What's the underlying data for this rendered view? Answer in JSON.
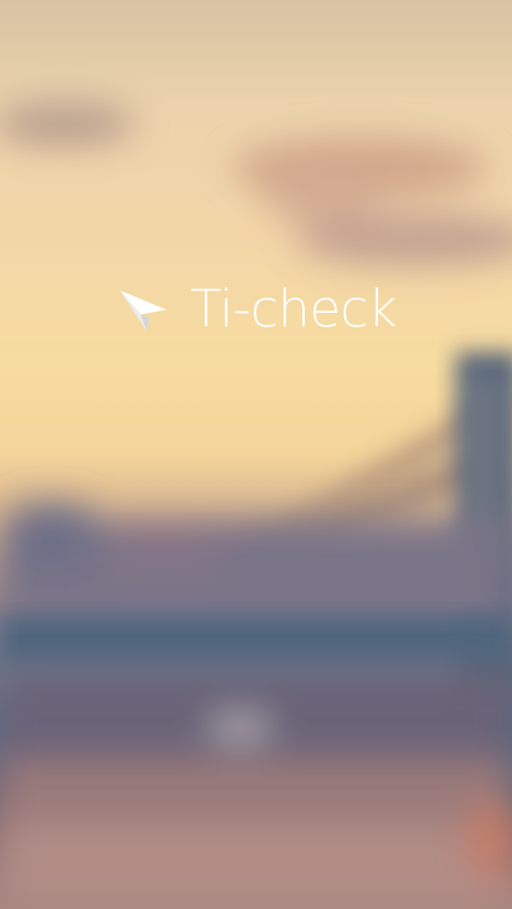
{
  "app": {
    "title": "Ti-check"
  },
  "logo": {
    "icon": "paper-plane-icon"
  },
  "background": {
    "description_colors": {
      "sky_top": "#d6c3a2",
      "sky_mid": "#f7dca0",
      "bridge": "#5c6b83",
      "water": "#a6837e"
    }
  }
}
